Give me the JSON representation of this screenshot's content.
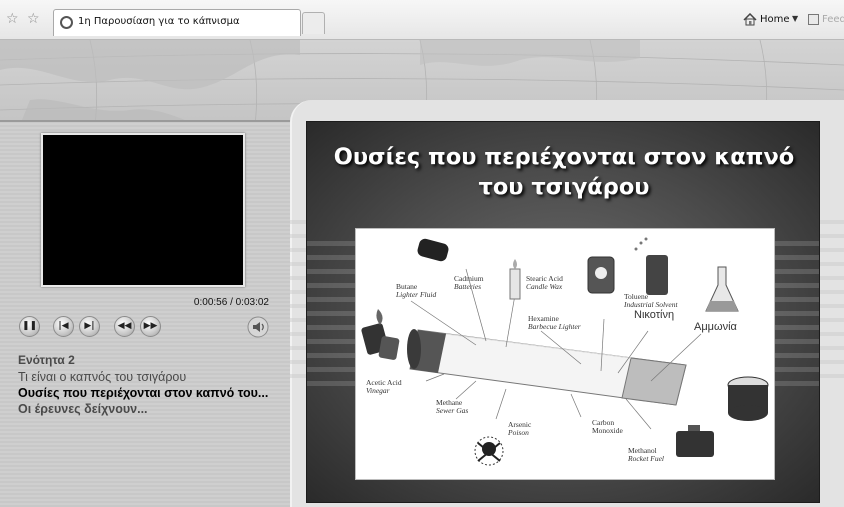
{
  "browser": {
    "tab_title": "1η Παρουσίαση για το κάπνισμα",
    "home_label": "Home",
    "feeds_label": "Feed"
  },
  "player": {
    "time": "0:00:56 / 0:03:02",
    "controls": [
      "pause",
      "previous",
      "next",
      "rewind",
      "fast-forward"
    ]
  },
  "nav": {
    "section": "Ενότητα 2",
    "items": [
      "Τι είναι ο καπνός του τσιγάρου",
      "Ουσίες που περιέχονται στον καπνό του...",
      "Οι έρευνες δείχνουν..."
    ],
    "current_index": 1
  },
  "slide": {
    "title": "Ουσίες που περιέχονται στον καπνό του τσιγάρου",
    "labels": {
      "butane": "Butane",
      "butane_use": "Lighter Fluid",
      "cadmium": "Cadmium",
      "cadmium_use": "Batteries",
      "stearic": "Stearic Acid",
      "stearic_use": "Candle Wax",
      "toluene": "Toluene",
      "toluene_use": "Industrial Solvent",
      "hexamine": "Hexamine",
      "hexamine_use": "Barbecue Lighter",
      "nicotine": "Νικοτίνη",
      "ammonia": "Αμμωνία",
      "acetic": "Acetic Acid",
      "acetic_use": "Vinegar",
      "methane": "Methane",
      "methane_use": "Sewer Gas",
      "arsenic": "Arsenic",
      "arsenic_use": "Poison",
      "carbon": "Carbon",
      "carbon_use": "Monoxide",
      "methanol": "Methanol",
      "methanol_use": "Rocket Fuel"
    }
  }
}
